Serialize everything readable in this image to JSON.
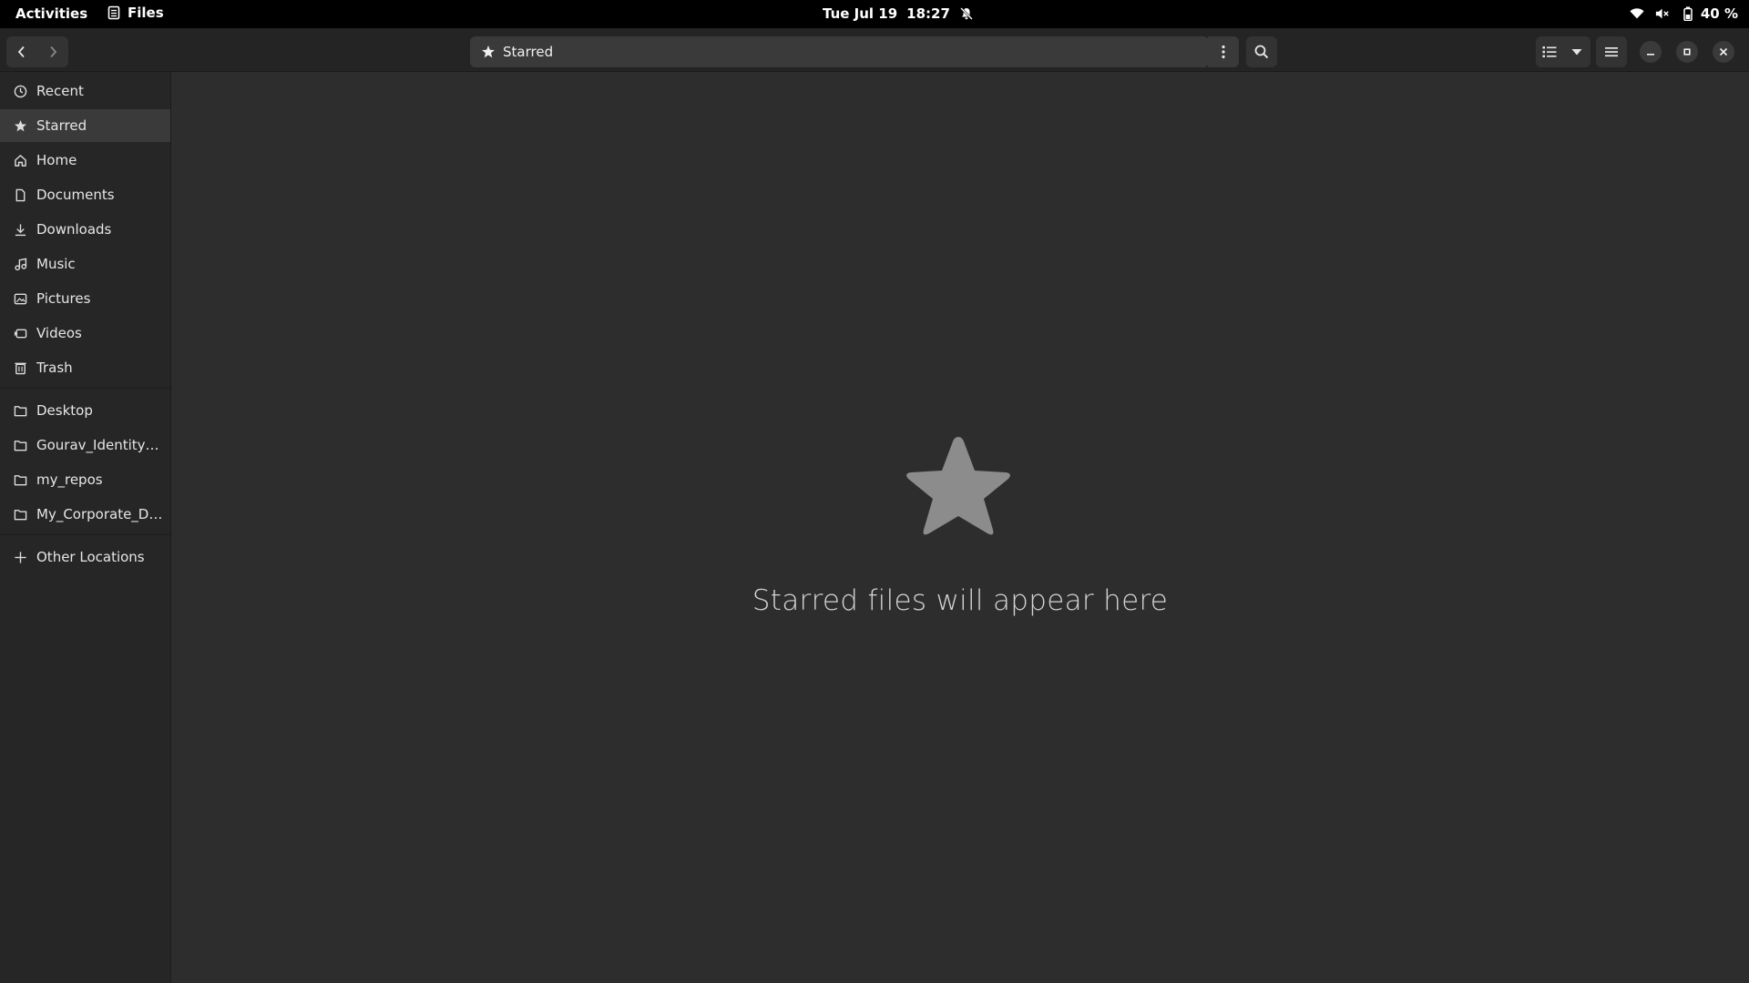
{
  "topbar": {
    "activities": "Activities",
    "app_name": "Files",
    "date": "Tue Jul 19",
    "time": "18:27",
    "battery": "40 %"
  },
  "header": {
    "location": "Starred"
  },
  "sidebar": {
    "places": [
      {
        "label": "Recent",
        "icon": "clock-icon"
      },
      {
        "label": "Starred",
        "icon": "star-icon"
      },
      {
        "label": "Home",
        "icon": "home-icon"
      },
      {
        "label": "Documents",
        "icon": "document-icon"
      },
      {
        "label": "Downloads",
        "icon": "download-icon"
      },
      {
        "label": "Music",
        "icon": "music-icon"
      },
      {
        "label": "Pictures",
        "icon": "picture-icon"
      },
      {
        "label": "Videos",
        "icon": "video-icon"
      },
      {
        "label": "Trash",
        "icon": "trash-icon"
      }
    ],
    "bookmarks": [
      {
        "label": "Desktop",
        "icon": "folder-icon"
      },
      {
        "label": "Gourav_Identity_I...",
        "icon": "folder-icon"
      },
      {
        "label": "my_repos",
        "icon": "folder-icon"
      },
      {
        "label": "My_Corporate_Do...",
        "icon": "folder-icon"
      }
    ],
    "other_locations": "Other Locations",
    "active_index": 1
  },
  "content": {
    "empty_message": "Starred files will appear here",
    "empty_icon": "star-icon"
  },
  "colors": {
    "topbar": "#000000",
    "headerbar": "#242424",
    "sidebar": "#262626",
    "content": "#2d2d2d",
    "active_item": "#3a3a3a",
    "empty_star": "#8c8c8c"
  }
}
